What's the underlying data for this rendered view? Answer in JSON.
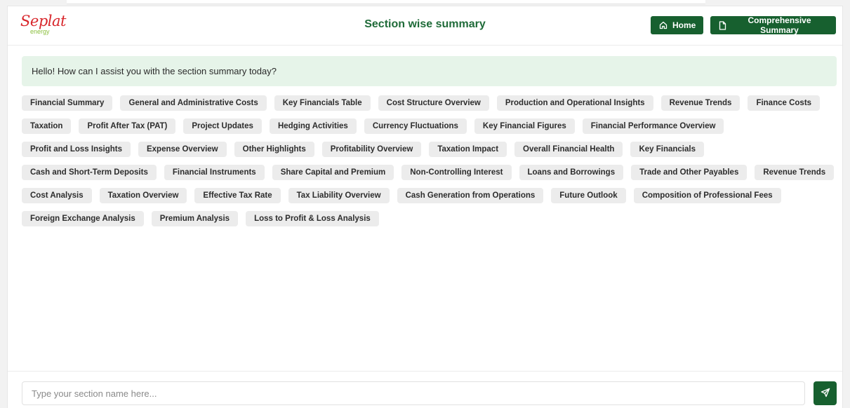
{
  "logo": {
    "text": "Seplat",
    "subtext": "energy"
  },
  "header": {
    "title": "Section wise summary",
    "home_label": "Home",
    "comprehensive_label": "Comprehensive Summary"
  },
  "chat": {
    "greeting": "Hello! How can I assist you with the section summary today?"
  },
  "sections": [
    "Financial Summary",
    "General and Administrative Costs",
    "Key Financials Table",
    "Cost Structure Overview",
    "Production and Operational Insights",
    "Revenue Trends",
    "Finance Costs",
    "Taxation",
    "Profit After Tax (PAT)",
    "Project Updates",
    "Hedging Activities",
    "Currency Fluctuations",
    "Key Financial Figures",
    "Financial Performance Overview",
    "Profit and Loss Insights",
    "Expense Overview",
    "Other Highlights",
    "Profitability Overview",
    "Taxation Impact",
    "Overall Financial Health",
    "Key Financials",
    "Cash and Short-Term Deposits",
    "Financial Instruments",
    "Share Capital and Premium",
    "Non-Controlling Interest",
    "Loans and Borrowings",
    "Trade and Other Payables",
    "Revenue Trends",
    "Cost Analysis",
    "Taxation Overview",
    "Effective Tax Rate",
    "Tax Liability Overview",
    "Cash Generation from Operations",
    "Future Outlook",
    "Composition of Professional Fees",
    "Foreign Exchange Analysis",
    "Premium Analysis",
    "Loss to Profit & Loss Analysis"
  ],
  "input": {
    "placeholder": "Type your section name here...",
    "value": ""
  },
  "icons": {
    "home": "home-icon",
    "comprehensive": "document-icon",
    "send": "send-icon"
  },
  "colors": {
    "brand_green": "#17602f",
    "title_green": "#1f6b39",
    "greeting_bg": "#e6f4e9",
    "logo_red": "#d8262b",
    "logo_lime": "#8bbf3d"
  }
}
